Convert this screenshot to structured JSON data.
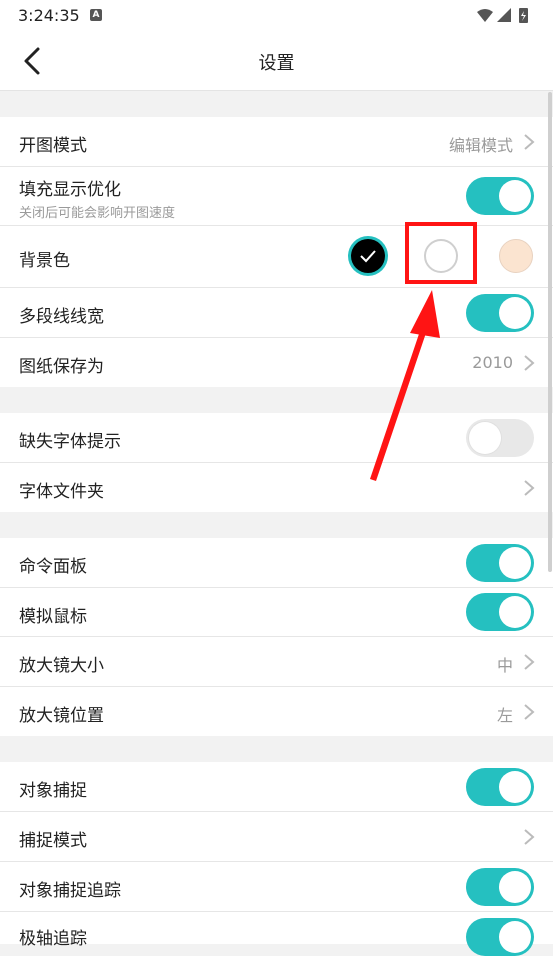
{
  "status_bar": {
    "time": "3:24:35",
    "badge": "A"
  },
  "header": {
    "title": "设置"
  },
  "settings": {
    "open_mode": {
      "label": "开图模式",
      "value": "编辑模式"
    },
    "fill_opt": {
      "label": "填充显示优化",
      "sub": "关闭后可能会影响开图速度",
      "on": true
    },
    "bg_color": {
      "label": "背景色",
      "options": [
        "#000000",
        "#ffffff",
        "#fbe4d0"
      ],
      "selected": "#000000"
    },
    "polyline_width": {
      "label": "多段线线宽",
      "on": true
    },
    "save_as": {
      "label": "图纸保存为",
      "value": "2010"
    },
    "missing_font": {
      "label": "缺失字体提示",
      "on": false
    },
    "font_folder": {
      "label": "字体文件夹"
    },
    "command_panel": {
      "label": "命令面板",
      "on": true
    },
    "sim_mouse": {
      "label": "模拟鼠标",
      "on": true
    },
    "magnifier_size": {
      "label": "放大镜大小",
      "value": "中"
    },
    "magnifier_pos": {
      "label": "放大镜位置",
      "value": "左"
    },
    "object_snap": {
      "label": "对象捕捉",
      "on": true
    },
    "snap_mode": {
      "label": "捕捉模式"
    },
    "snap_tracking": {
      "label": "对象捕捉追踪",
      "on": true
    },
    "polar_tracking": {
      "label": "极轴追踪",
      "on": true
    }
  },
  "colors": {
    "accent": "#25c0c0",
    "highlight": "#ff1414"
  }
}
